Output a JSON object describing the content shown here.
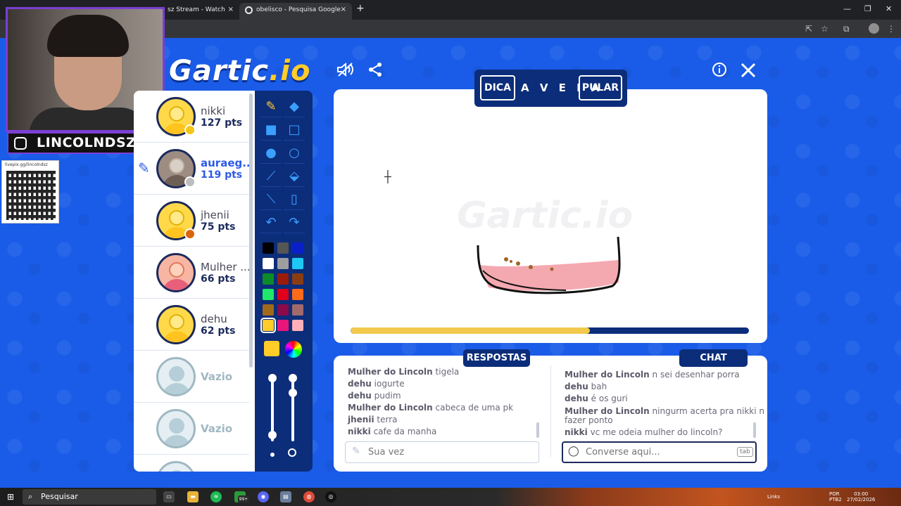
{
  "browser": {
    "tabs": [
      {
        "label": "sz Stream - Watch Live",
        "close": "×"
      },
      {
        "label": "obelisco - Pesquisa Google",
        "close": "×"
      }
    ],
    "new_tab": "+",
    "window_controls": [
      "—",
      "❐",
      "✕"
    ]
  },
  "stream": {
    "handle": "LINCOLNDSZ",
    "qr_url": "livepix.gg/lincolndsz"
  },
  "game": {
    "logo_main": "Gartic",
    "logo_suffix": ".io",
    "canvas_watermark": "Gartic.io",
    "hint_button": "DICA",
    "word": "A V E I A",
    "skip_button": "PULAR",
    "timer_progress": 0.6,
    "icons": [
      "mute-icon",
      "share-icon",
      "info-icon",
      "close-icon"
    ]
  },
  "players": [
    {
      "name": "nikki",
      "points": "127 pts",
      "avatar": "default",
      "status_color": "#f5c518",
      "drawing": false
    },
    {
      "name": "auraeg...",
      "points": "119 pts",
      "avatar": "photo",
      "status_color": "#bdbdbd",
      "drawing": true
    },
    {
      "name": "jhenii",
      "points": "75 pts",
      "avatar": "default",
      "status_color": "#d9660b",
      "drawing": false
    },
    {
      "name": "Mulher ...",
      "points": "66 pts",
      "avatar": "girl",
      "status_color": "",
      "drawing": false
    },
    {
      "name": "dehu",
      "points": "62 pts",
      "avatar": "default",
      "status_color": "",
      "drawing": false
    },
    {
      "name": "Vazio",
      "points": "",
      "avatar": "empty",
      "status_color": "",
      "drawing": false
    },
    {
      "name": "Vazio",
      "points": "",
      "avatar": "empty",
      "status_color": "",
      "drawing": false
    }
  ],
  "palette": {
    "colors": [
      [
        "#000000",
        "#555555",
        "#0a1fc9"
      ],
      [
        "#ffffff",
        "#9e9e9e",
        "#1ec8f5"
      ],
      [
        "#0d8a2a",
        "#9a1b0a",
        "#8a3d12"
      ],
      [
        "#1fe86a",
        "#e0001b",
        "#ff6a1a"
      ],
      [
        "#a06a1a",
        "#8a0a4a",
        "#a06a6a"
      ],
      [
        "#ffcc2a",
        "#e8157a",
        "#ffb0b8"
      ]
    ],
    "selected_color": "#ffcc2a"
  },
  "answers": {
    "header": "RESPOSTAS",
    "messages": [
      {
        "user": "Mulher do Lincoln",
        "text": "tigela"
      },
      {
        "user": "dehu",
        "text": "iogurte"
      },
      {
        "user": "dehu",
        "text": "pudim"
      },
      {
        "user": "Mulher do Lincoln",
        "text": "cabeca de uma pk"
      },
      {
        "user": "jhenii",
        "text": "terra"
      },
      {
        "user": "nikki",
        "text": "cafe da manha"
      }
    ],
    "input_placeholder": "Sua vez"
  },
  "chat": {
    "header": "CHAT",
    "messages": [
      {
        "user": "Mulher do Lincoln",
        "text": "n sei desenhar porra"
      },
      {
        "user": "dehu",
        "text": "bah"
      },
      {
        "user": "dehu",
        "text": "é os guri"
      },
      {
        "user": "Mulher do Lincoln",
        "text": "ningurm acerta pra nikki n"
      },
      {
        "user": "",
        "text": "fazer ponto"
      },
      {
        "user": "nikki",
        "text": "vc me odeia mulher do lincoln?"
      }
    ],
    "input_placeholder": "Converse aqui...",
    "tab_key": "tab"
  },
  "taskbar": {
    "search_label": "Pesquisar",
    "badge": "99+",
    "tray_links": "Links",
    "lang_top": "POR",
    "lang_bottom": "PTB2",
    "time": "03:00",
    "date": "27/02/2026"
  }
}
